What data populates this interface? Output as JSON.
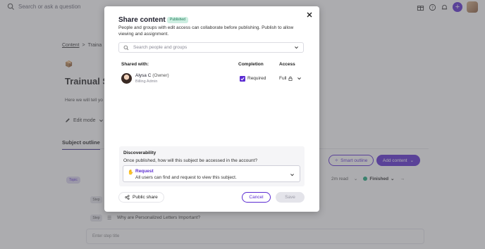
{
  "topbar": {
    "search_placeholder": "Search or ask a question",
    "icons": [
      "search-icon",
      "gift-icon",
      "help-icon",
      "bell-icon",
      "plus-icon",
      "avatar"
    ]
  },
  "background": {
    "breadcrumb": {
      "root": "Content",
      "separator": ">",
      "current": "Traina"
    },
    "subject_emoji": "📦",
    "subject_title": "Trainual S",
    "subject_desc": "Here we will tell yo",
    "edit_mode": "Edit mode",
    "tab_outline": "Subject outline",
    "smart_outline": "Smart outline",
    "add_content": "Add content",
    "topic_badge": "Topic",
    "read_time": "2m read",
    "status": "Finished",
    "step_badge": "Step",
    "step_title": "Why are Personalized Letters Important?",
    "enter_step": "Enter step title"
  },
  "modal": {
    "title": "Share content",
    "badge": "Published",
    "description": "People and groups with edit access can collaborate before publishing. Publish to allow viewing and assignment.",
    "search_placeholder": "Search people and groups",
    "headers": {
      "shared_with": "Shared with:",
      "completion": "Completion",
      "access": "Access"
    },
    "user": {
      "name": "Alysa C",
      "owner_tag": "(Owner)",
      "role": "Billing Admin",
      "completion_label": "Required",
      "completion_checked": true,
      "access": "Full"
    },
    "discoverability": {
      "title": "Discoverability",
      "question": "Once published, how will this subject be accessed in the account?",
      "option_title": "Request",
      "option_desc": "All users can find and request to view this subject."
    },
    "public_share": "Public share",
    "cancel": "Cancel",
    "save": "Save"
  },
  "colors": {
    "accent": "#5b2bd1",
    "badge_bg": "#cdeee1",
    "badge_text": "#1c7a57",
    "status_green": "#1aa97a"
  }
}
